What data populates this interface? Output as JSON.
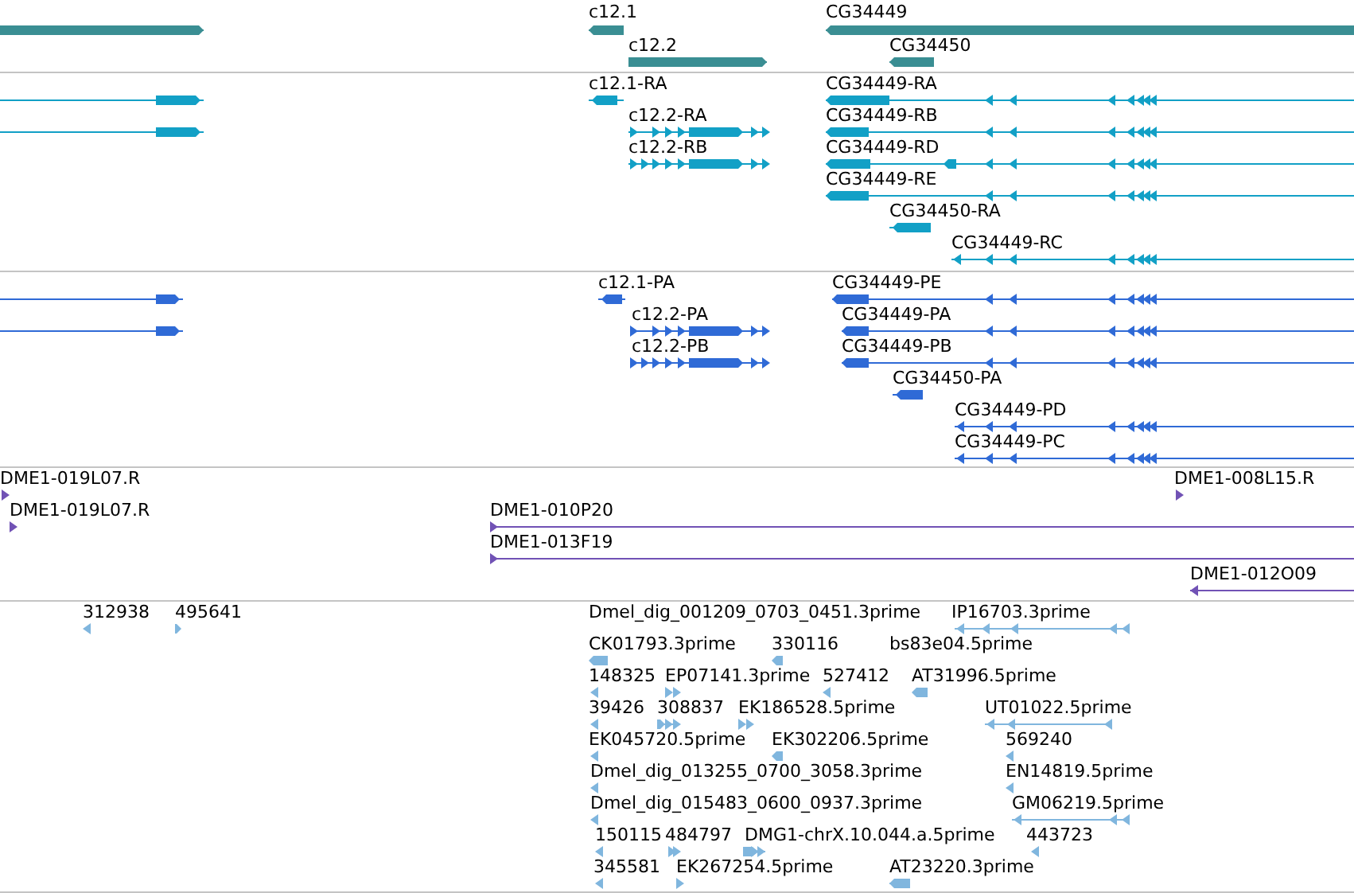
{
  "tracks": [
    {
      "color": "#3a8e93",
      "features": [
        "c12.1",
        "CG34449",
        "c12.2",
        "CG34450"
      ]
    },
    {
      "color": "#12a0c6",
      "features": [
        "c12.1-RA",
        "CG34449-RA",
        "c12.2-RA",
        "CG34449-RB",
        "c12.2-RB",
        "CG34449-RD",
        "CG34449-RE",
        "CG34450-RA",
        "CG34449-RC"
      ]
    },
    {
      "color": "#2f6ad6",
      "features": [
        "c12.1-PA",
        "CG34449-PE",
        "c12.2-PA",
        "CG34449-PA",
        "c12.2-PB",
        "CG34449-PB",
        "CG34450-PA",
        "CG34449-PD",
        "CG34449-PC"
      ]
    },
    {
      "color": "#7152b5",
      "features": [
        "DME1-019L07.R",
        "DME1-008L15.R",
        "DME1-019L07.R",
        "DME1-010P20",
        "DME1-013F19",
        "DME1-012O09"
      ]
    },
    {
      "color": "#80b6de",
      "features": [
        "312938",
        "495641",
        "Dmel_dig_001209_0703_0451.3prime",
        "IP16703.3prime",
        "CK01793.3prime",
        "330116",
        "bs83e04.5prime",
        "148325",
        "EP07141.3prime",
        "527412",
        "AT31996.5prime",
        "39426",
        "308837",
        "EK186528.5prime",
        "UT01022.5prime",
        "EK045720.5prime",
        "EK302206.5prime",
        "569240",
        "Dmel_dig_013255_0700_3058.3prime",
        "EN14819.5prime",
        "Dmel_dig_015483_0600_0937.3prime",
        "GM06219.5prime",
        "150115",
        "484797",
        "DMG1-chrX.10.044.a.5prime",
        "443723",
        "345581",
        "EK267254.5prime",
        "AT23220.3prime"
      ]
    }
  ]
}
